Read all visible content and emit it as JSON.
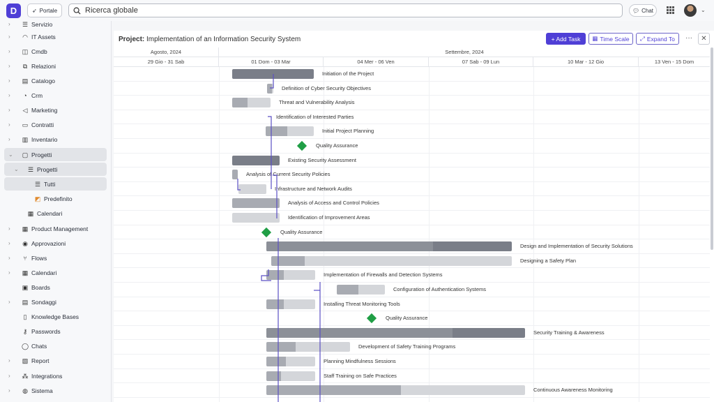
{
  "topbar": {
    "portal_label": "Portale",
    "search_placeholder": "Ricerca globale",
    "chat_label": "Chat"
  },
  "sidebar": {
    "items": [
      {
        "label": "Servizio",
        "icon": "service-icon",
        "arrow": true
      },
      {
        "label": "IT Assets",
        "icon": "wifi-icon",
        "arrow": true
      },
      {
        "label": "Cmdb",
        "icon": "database-icon",
        "arrow": true
      },
      {
        "label": "Relazioni",
        "icon": "hierarchy-icon",
        "arrow": true
      },
      {
        "label": "Catalogo",
        "icon": "clipboard-icon",
        "arrow": true
      },
      {
        "label": "Crm",
        "icon": "crm-icon",
        "arrow": true
      },
      {
        "label": "Marketing",
        "icon": "megaphone-icon",
        "arrow": true
      },
      {
        "label": "Contratti",
        "icon": "contract-icon",
        "arrow": true
      },
      {
        "label": "Inventario",
        "icon": "inventory-icon",
        "arrow": true
      },
      {
        "label": "Progetti",
        "icon": "projects-icon",
        "arrow": true,
        "expanded": true,
        "active": true
      },
      {
        "label": "Progetti",
        "icon": "list-icon",
        "arrow": true,
        "expanded": true,
        "active": true,
        "level": 1
      },
      {
        "label": "Tutti",
        "icon": "list-icon",
        "arrow": false,
        "active": true,
        "level": 2
      },
      {
        "label": "Predefinito",
        "icon": "stack-icon",
        "arrow": false,
        "level": 2
      },
      {
        "label": "Calendari",
        "icon": "calendar-icon",
        "arrow": false,
        "level": 1
      },
      {
        "label": "Product Management",
        "icon": "calendar-icon",
        "arrow": true
      },
      {
        "label": "Approvazioni",
        "icon": "check-circle-icon",
        "arrow": true
      },
      {
        "label": "Flows",
        "icon": "branch-icon",
        "arrow": true
      },
      {
        "label": "Calendari",
        "icon": "calendar-icon",
        "arrow": true
      },
      {
        "label": "Boards",
        "icon": "board-icon",
        "arrow": false
      },
      {
        "label": "Sondaggi",
        "icon": "survey-icon",
        "arrow": true
      },
      {
        "label": "Knowledge Bases",
        "icon": "book-icon",
        "arrow": false
      },
      {
        "label": "Passwords",
        "icon": "key-icon",
        "arrow": false
      },
      {
        "label": "Chats",
        "icon": "chat-icon",
        "arrow": false
      },
      {
        "label": "Report",
        "icon": "report-icon",
        "arrow": true
      },
      {
        "label": "Integrations",
        "icon": "integrations-icon",
        "arrow": true
      },
      {
        "label": "Sistema",
        "icon": "globe-icon",
        "arrow": true
      }
    ]
  },
  "main": {
    "title_prefix": "Project:",
    "title": "Implementation of an Information Security System",
    "add_task_label": "+ Add Task",
    "time_scale_label": "Time Scale",
    "expand_label": "Expand To",
    "header_months": [
      "Agosto, 2024",
      "Settembre, 2024"
    ],
    "header_weeks": [
      "29 Gio - 31 Sab",
      "01 Dom - 03 Mar",
      "04 Mer - 06 Ven",
      "07 Sab - 09 Lun",
      "10 Mar - 12 Gio",
      "13 Ven - 15 Dom"
    ]
  },
  "tasks": [
    {
      "name": "Initiation of the Project",
      "type": "summary",
      "progress": 0
    },
    {
      "name": "Definition of Cyber Security Objectives",
      "type": "task",
      "progress": 0.8
    },
    {
      "name": "Threat and Vulnerability Analysis",
      "type": "task",
      "progress": 0.4
    },
    {
      "name": "Identification of Interested Parties",
      "type": "task",
      "progress": 0
    },
    {
      "name": "Initial Project Planning",
      "type": "task",
      "progress": 0.45
    },
    {
      "name": "Quality Assurance",
      "type": "milestone"
    },
    {
      "name": "Existing Security Assessment",
      "type": "summary",
      "progress": 0
    },
    {
      "name": "Analysis of Current Security Policies",
      "type": "task",
      "progress": 1
    },
    {
      "name": "Infrastructure and Network Audits",
      "type": "task",
      "progress": 0
    },
    {
      "name": "Analysis of Access and Control Policies",
      "type": "task",
      "progress": 1
    },
    {
      "name": "Identification of Improvement Areas",
      "type": "task",
      "progress": 0
    },
    {
      "name": "Quality Assurance",
      "type": "milestone"
    },
    {
      "name": "Design and Implementation of Security Solutions",
      "type": "summary",
      "progress": 0.68
    },
    {
      "name": "Designing a Safety Plan",
      "type": "task",
      "progress": 0.14
    },
    {
      "name": "Implementation of Firewalls and Detection Systems",
      "type": "task",
      "progress": 0.35
    },
    {
      "name": "Configuration of Authentication Systems",
      "type": "task",
      "progress": 0.45
    },
    {
      "name": "Installing Threat Monitoring Tools",
      "type": "task",
      "progress": 0.35
    },
    {
      "name": "Quality Assurance",
      "type": "milestone"
    },
    {
      "name": "Security Training & Awareness",
      "type": "summary",
      "progress": 0.72
    },
    {
      "name": "Development of Safety Training Programs",
      "type": "task",
      "progress": 0.35
    },
    {
      "name": "Planning Mindfulness Sessions",
      "type": "task",
      "progress": 0.4
    },
    {
      "name": "Staff Training on Safe Practices",
      "type": "task",
      "progress": 0.3
    },
    {
      "name": "Continuous Awareness Monitoring",
      "type": "task",
      "progress": 0.52
    }
  ]
}
